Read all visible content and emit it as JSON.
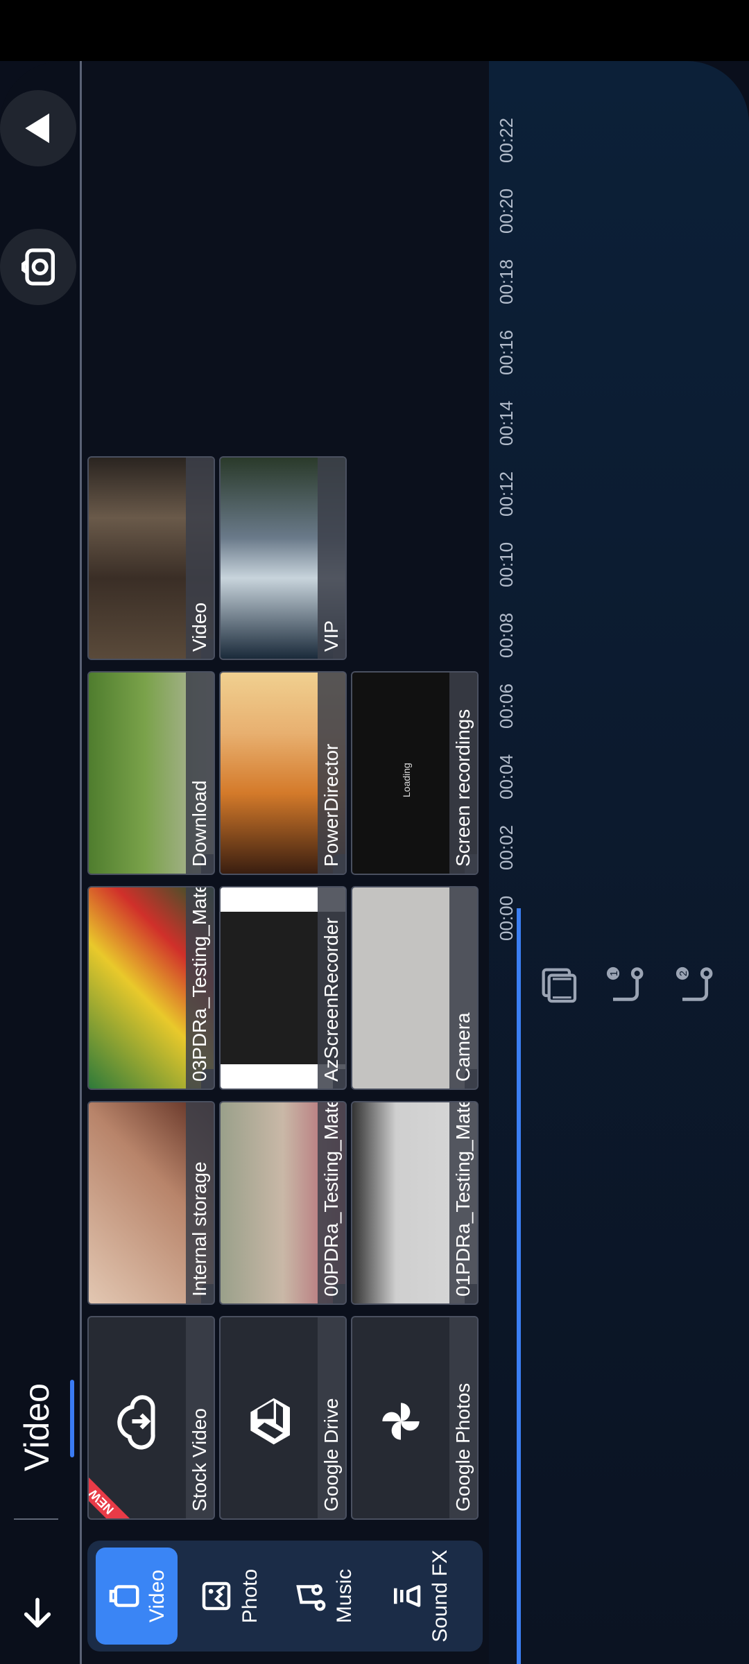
{
  "header": {
    "title": "Video"
  },
  "tabs": [
    {
      "label": "Video",
      "icon": "video-icon",
      "active": true
    },
    {
      "label": "Photo",
      "icon": "photo-icon",
      "active": false
    },
    {
      "label": "Music",
      "icon": "music-icon",
      "active": false
    },
    {
      "label": "Sound FX",
      "icon": "sound-fx-icon",
      "active": false
    }
  ],
  "services": [
    {
      "label": "Stock Video",
      "icon": "cloud-download-icon",
      "badge": "NEW"
    },
    {
      "label": "Google Drive",
      "icon": "google-drive-icon"
    },
    {
      "label": "Google Photos",
      "icon": "google-photos-icon"
    }
  ],
  "folders": {
    "col1": [
      "Internal storage",
      "00PDRa_Testing_Mate",
      "01PDRa_Testing_Mate"
    ],
    "col2": [
      "03PDRa_Testing_Mate",
      "AzScreenRecorder",
      "Camera"
    ],
    "col3": [
      "Download",
      "PowerDirector",
      "Screen recordings"
    ],
    "col4": [
      "Video",
      "VIP"
    ]
  },
  "loading_text": "Loading",
  "ruler": [
    "00:00",
    "00:02",
    "00:04",
    "00:06",
    "00:08",
    "00:10",
    "00:12",
    "00:14",
    "00:16",
    "00:18",
    "00:20",
    "00:22"
  ],
  "colors": {
    "accent": "#3a85f5",
    "badge": "#e83b47",
    "panel": "#1b2c47"
  }
}
